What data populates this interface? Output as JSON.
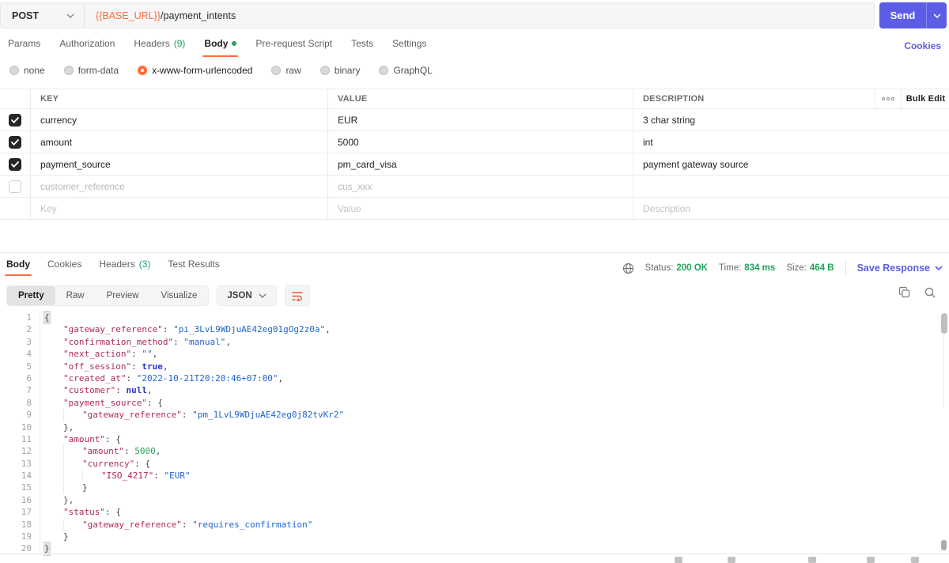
{
  "colors": {
    "accent_orange": "#ff6c37",
    "accent_green": "#1ea45b",
    "accent_indigo": "#5c5ce6",
    "json_key": "#ae2a5d",
    "json_string": "#2064ce",
    "json_atom": "#2b35c8",
    "json_number": "#2aa15d"
  },
  "request": {
    "method": "POST",
    "url_var": "{{BASE_URL}}",
    "url_path": "/payment_intents",
    "send_label": "Send",
    "cookies_label": "Cookies",
    "tabs": [
      {
        "label": "Params"
      },
      {
        "label": "Authorization"
      },
      {
        "label": "Headers",
        "count": "(9)"
      },
      {
        "label": "Body",
        "active": true,
        "dot": true
      },
      {
        "label": "Pre-request Script"
      },
      {
        "label": "Tests"
      },
      {
        "label": "Settings"
      }
    ],
    "body_modes": [
      {
        "label": "none"
      },
      {
        "label": "form-data"
      },
      {
        "label": "x-www-form-urlencoded",
        "selected": true
      },
      {
        "label": "raw"
      },
      {
        "label": "binary"
      },
      {
        "label": "GraphQL"
      }
    ],
    "table": {
      "headers": {
        "key": "KEY",
        "value": "VALUE",
        "description": "DESCRIPTION"
      },
      "bulk_edit_label": "Bulk Edit",
      "rows": [
        {
          "checked": true,
          "key": "currency",
          "value": "EUR",
          "description": "3 char string"
        },
        {
          "checked": true,
          "key": "amount",
          "value": "5000",
          "description": "int"
        },
        {
          "checked": true,
          "key": "payment_source",
          "value": "pm_card_visa",
          "description": "payment gateway source"
        },
        {
          "checked": false,
          "muted": true,
          "key": "customer_reference",
          "value": "cus_xxx",
          "description": ""
        },
        {
          "placeholder": true,
          "key": "Key",
          "value": "Value",
          "description": "Description"
        }
      ]
    }
  },
  "response": {
    "tabs": [
      {
        "label": "Body",
        "active": true
      },
      {
        "label": "Cookies"
      },
      {
        "label": "Headers",
        "count": "(3)"
      },
      {
        "label": "Test Results"
      }
    ],
    "meta": [
      {
        "label": "Status:",
        "value": "200 OK"
      },
      {
        "label": "Time:",
        "value": "834 ms"
      },
      {
        "label": "Size:",
        "value": "464 B"
      }
    ],
    "save_label": "Save Response",
    "view_tabs": [
      {
        "label": "Pretty",
        "active": true
      },
      {
        "label": "Raw"
      },
      {
        "label": "Preview"
      },
      {
        "label": "Visualize"
      }
    ],
    "format": "JSON",
    "code_lines": [
      {
        "ind": 0,
        "toks": [
          {
            "t": "hb",
            "v": "{"
          }
        ]
      },
      {
        "ind": 1,
        "toks": [
          {
            "t": "k",
            "v": "\"gateway_reference\""
          },
          {
            "t": "p",
            "v": ": "
          },
          {
            "t": "s",
            "v": "\"pi_3LvL9WDjuAE42eg01gOg2z0a\""
          },
          {
            "t": "p",
            "v": ","
          }
        ]
      },
      {
        "ind": 1,
        "toks": [
          {
            "t": "k",
            "v": "\"confirmation_method\""
          },
          {
            "t": "p",
            "v": ": "
          },
          {
            "t": "s",
            "v": "\"manual\""
          },
          {
            "t": "p",
            "v": ","
          }
        ]
      },
      {
        "ind": 1,
        "toks": [
          {
            "t": "k",
            "v": "\"next_action\""
          },
          {
            "t": "p",
            "v": ": "
          },
          {
            "t": "s",
            "v": "\"\""
          },
          {
            "t": "p",
            "v": ","
          }
        ]
      },
      {
        "ind": 1,
        "toks": [
          {
            "t": "k",
            "v": "\"off_session\""
          },
          {
            "t": "p",
            "v": ": "
          },
          {
            "t": "a",
            "v": "true"
          },
          {
            "t": "p",
            "v": ","
          }
        ]
      },
      {
        "ind": 1,
        "toks": [
          {
            "t": "k",
            "v": "\"created_at\""
          },
          {
            "t": "p",
            "v": ": "
          },
          {
            "t": "s",
            "v": "\"2022-10-21T20:20:46+07:00\""
          },
          {
            "t": "p",
            "v": ","
          }
        ]
      },
      {
        "ind": 1,
        "toks": [
          {
            "t": "k",
            "v": "\"customer\""
          },
          {
            "t": "p",
            "v": ": "
          },
          {
            "t": "a",
            "v": "null"
          },
          {
            "t": "p",
            "v": ","
          }
        ]
      },
      {
        "ind": 1,
        "toks": [
          {
            "t": "k",
            "v": "\"payment_source\""
          },
          {
            "t": "p",
            "v": ": {"
          }
        ]
      },
      {
        "ind": 2,
        "toks": [
          {
            "t": "k",
            "v": "\"gateway_reference\""
          },
          {
            "t": "p",
            "v": ": "
          },
          {
            "t": "s",
            "v": "\"pm_1LvL9WDjuAE42eg0j82tvKr2\""
          }
        ]
      },
      {
        "ind": 1,
        "toks": [
          {
            "t": "p",
            "v": "},"
          }
        ]
      },
      {
        "ind": 1,
        "toks": [
          {
            "t": "k",
            "v": "\"amount\""
          },
          {
            "t": "p",
            "v": ": {"
          }
        ]
      },
      {
        "ind": 2,
        "toks": [
          {
            "t": "k",
            "v": "\"amount\""
          },
          {
            "t": "p",
            "v": ": "
          },
          {
            "t": "n",
            "v": "5000"
          },
          {
            "t": "p",
            "v": ","
          }
        ]
      },
      {
        "ind": 2,
        "toks": [
          {
            "t": "k",
            "v": "\"currency\""
          },
          {
            "t": "p",
            "v": ": {"
          }
        ]
      },
      {
        "ind": 3,
        "toks": [
          {
            "t": "k",
            "v": "\"ISO_4217\""
          },
          {
            "t": "p",
            "v": ": "
          },
          {
            "t": "s",
            "v": "\"EUR\""
          }
        ]
      },
      {
        "ind": 2,
        "toks": [
          {
            "t": "p",
            "v": "}"
          }
        ]
      },
      {
        "ind": 1,
        "toks": [
          {
            "t": "p",
            "v": "},"
          }
        ]
      },
      {
        "ind": 1,
        "toks": [
          {
            "t": "k",
            "v": "\"status\""
          },
          {
            "t": "p",
            "v": ": {"
          }
        ]
      },
      {
        "ind": 2,
        "toks": [
          {
            "t": "k",
            "v": "\"gateway_reference\""
          },
          {
            "t": "p",
            "v": ": "
          },
          {
            "t": "s",
            "v": "\"requires_confirmation\""
          }
        ]
      },
      {
        "ind": 1,
        "toks": [
          {
            "t": "p",
            "v": "}"
          }
        ]
      },
      {
        "ind": 0,
        "toks": [
          {
            "t": "hb",
            "v": "}"
          }
        ]
      }
    ]
  }
}
